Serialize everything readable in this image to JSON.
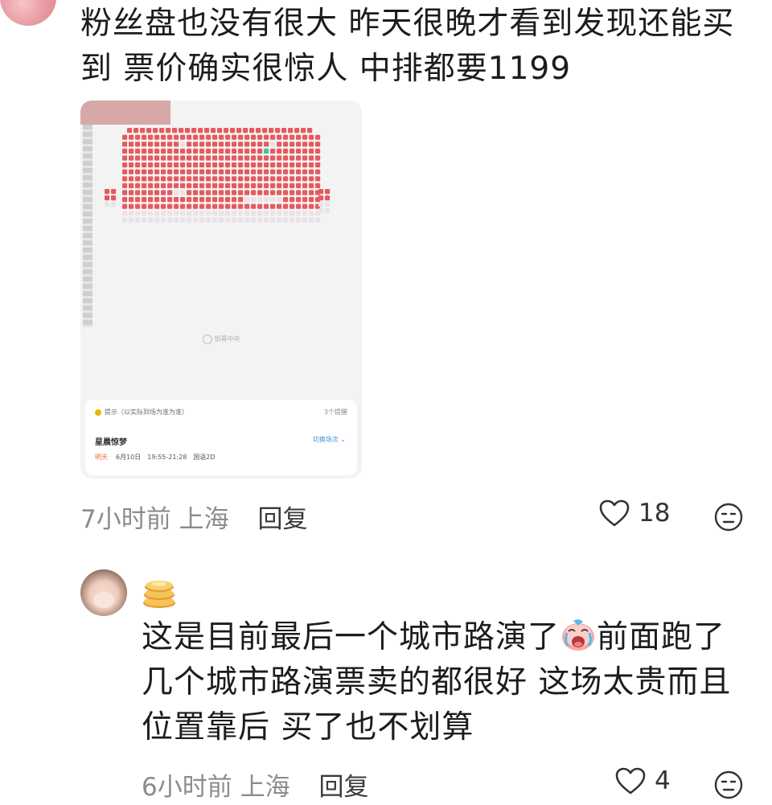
{
  "comment1": {
    "text": "粉丝盘也没有很大 昨天很晚才看到发现还能买到 票价确实很惊人 中排都要1199",
    "screenshot": {
      "screen_label": "银幕中央",
      "notice": "提示（以实际到场为准为准）",
      "notice_count": "3个提醒",
      "movie": "星晨惊梦",
      "switch": "切换场次 ⌄",
      "day": "明天",
      "date": "6月10日",
      "time": "19:55-21:28",
      "version": "国语2D"
    },
    "time": "7小时前",
    "location": "上海",
    "reply": "回复",
    "likes": "18"
  },
  "comment2": {
    "badge_icon": "pancake-stack-icon",
    "text_before_emoji": "这是目前最后一个城市路演了",
    "emoji": "crying-face-icon",
    "text_after_emoji": "前面跑了几个城市路演票卖的都很好 这场太贵而且位置靠后 买了也不划算",
    "time": "6小时前",
    "location": "上海",
    "reply": "回复",
    "likes": "4"
  },
  "colors": {
    "sold_seat": "#e55a5e",
    "available_seat": "#e9e3e6",
    "selected_seat": "#3cc7a3",
    "meta_gray": "#8c8c8c"
  }
}
